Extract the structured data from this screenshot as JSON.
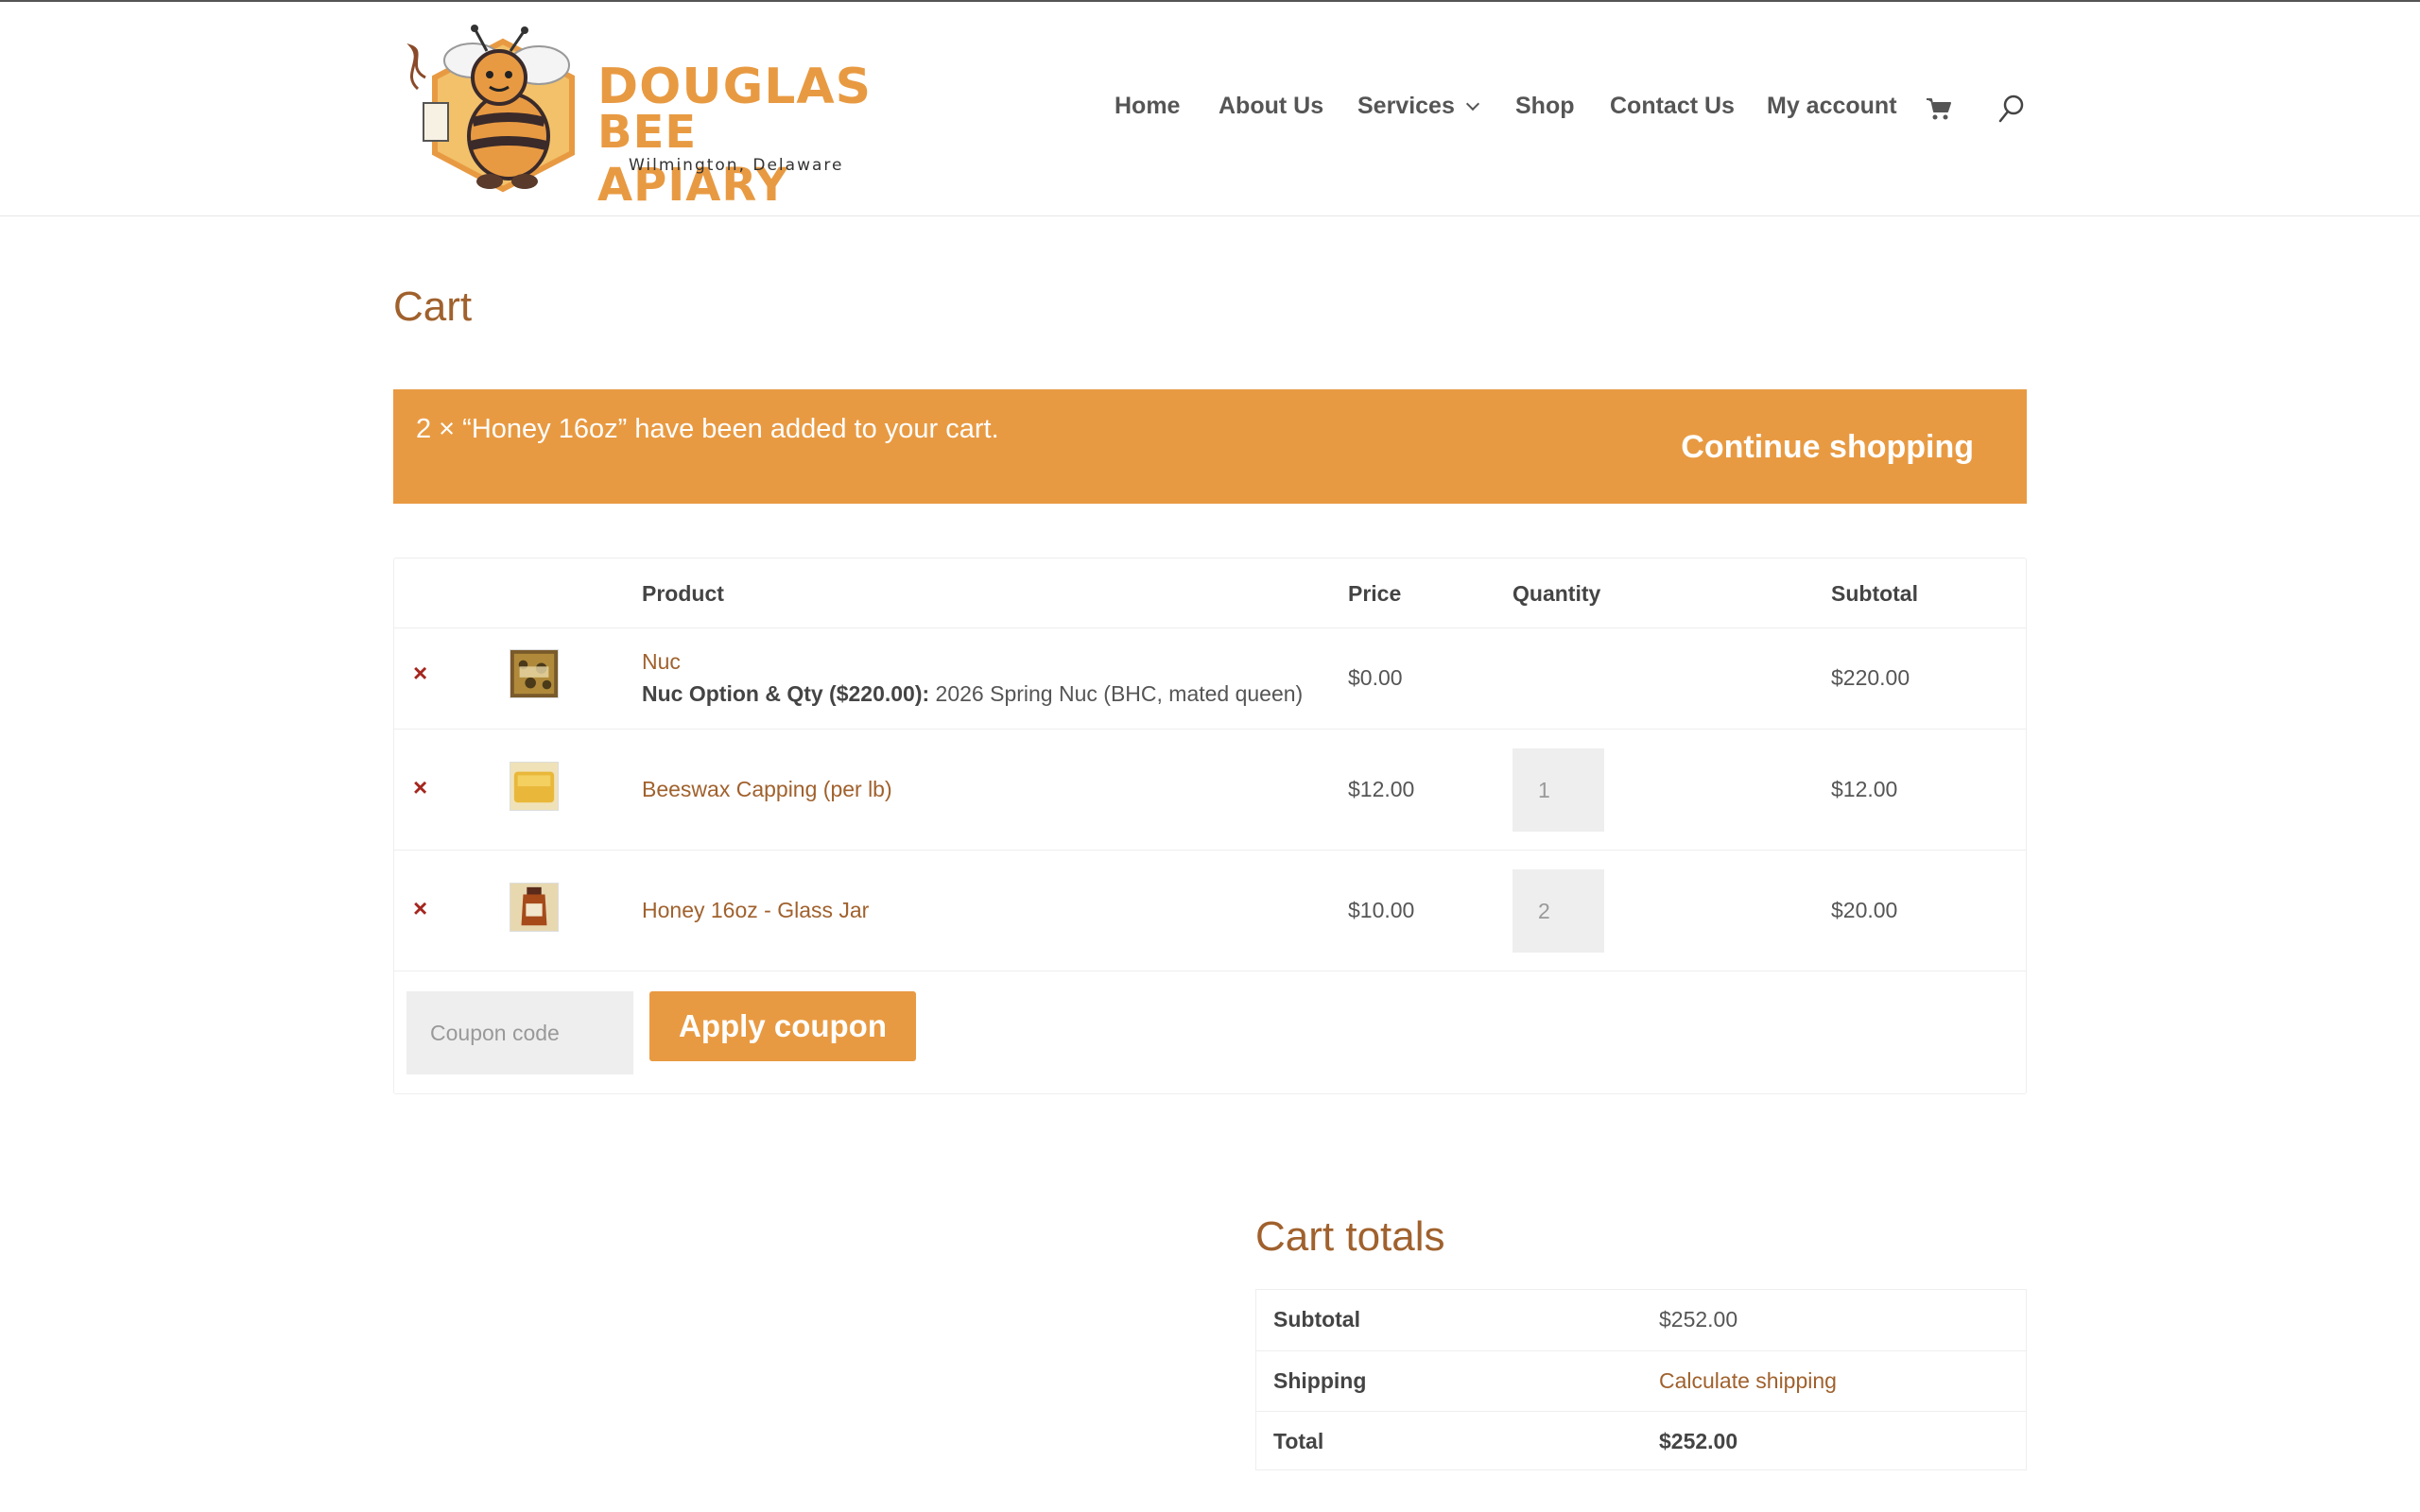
{
  "brand": {
    "line1": "DOUGLAS",
    "line2": "BEE APIARY",
    "location": "Wilmington, Delaware"
  },
  "nav": {
    "items": [
      {
        "label": "Home"
      },
      {
        "label": "About Us"
      },
      {
        "label": "Services"
      },
      {
        "label": "Shop"
      },
      {
        "label": "Contact Us"
      },
      {
        "label": "My account"
      }
    ],
    "cart_icon": "cart-icon",
    "search_icon": "search-icon"
  },
  "page": {
    "title": "Cart"
  },
  "notice": {
    "message": "2 × “Honey 16oz” have been added to your cart.",
    "button": "Continue shopping"
  },
  "cart": {
    "headers": {
      "product": "Product",
      "price": "Price",
      "quantity": "Quantity",
      "subtotal": "Subtotal"
    },
    "remove_symbol": "×",
    "items": [
      {
        "name": "Nuc",
        "meta_label": "Nuc Option & Qty ($220.00):",
        "meta_value": " 2026 Spring Nuc (BHC, mated queen)",
        "price": "$0.00",
        "quantity": "",
        "subtotal": "$220.00"
      },
      {
        "name": "Beeswax Capping (per lb)",
        "price": "$12.00",
        "quantity": "1",
        "subtotal": "$12.00"
      },
      {
        "name": "Honey 16oz - Glass Jar",
        "price": "$10.00",
        "quantity": "2",
        "subtotal": "$20.00"
      }
    ],
    "coupon_placeholder": "Coupon code",
    "apply_coupon": "Apply coupon"
  },
  "totals": {
    "title": "Cart totals",
    "subtotal_label": "Subtotal",
    "subtotal_value": "$252.00",
    "shipping_label": "Shipping",
    "shipping_value": "Calculate shipping",
    "total_label": "Total",
    "total_value": "$252.00"
  },
  "colors": {
    "accent": "#e89a42",
    "link": "#a0612d",
    "remove": "#a5261e"
  }
}
